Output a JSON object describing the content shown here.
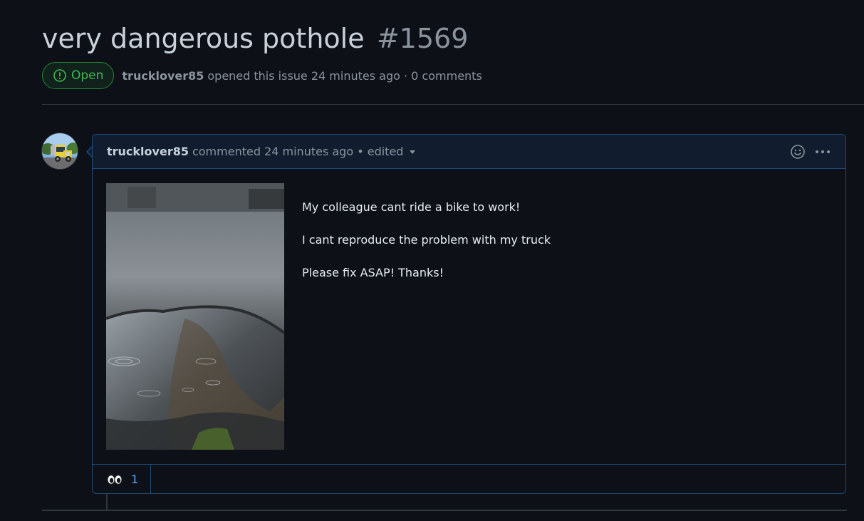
{
  "issue": {
    "title": "very dangerous pothole",
    "number": "#1569",
    "state": "Open",
    "author": "trucklover85",
    "opened_text": "opened this issue 24 minutes ago · 0 comments"
  },
  "comment": {
    "author": "trucklover85",
    "meta": "commented 24 minutes ago • edited",
    "lines": [
      "My colleague cant ride a bike to work!",
      "I cant reproduce the problem with my truck",
      "Please fix ASAP! Thanks!"
    ],
    "reactions": [
      {
        "icon": "eyes-icon",
        "count": "1"
      }
    ]
  },
  "colors": {
    "background": "#0d1117",
    "open_green": "#3fb950",
    "accent_blue": "#58a6ff",
    "comment_border": "#1f4a7a"
  }
}
